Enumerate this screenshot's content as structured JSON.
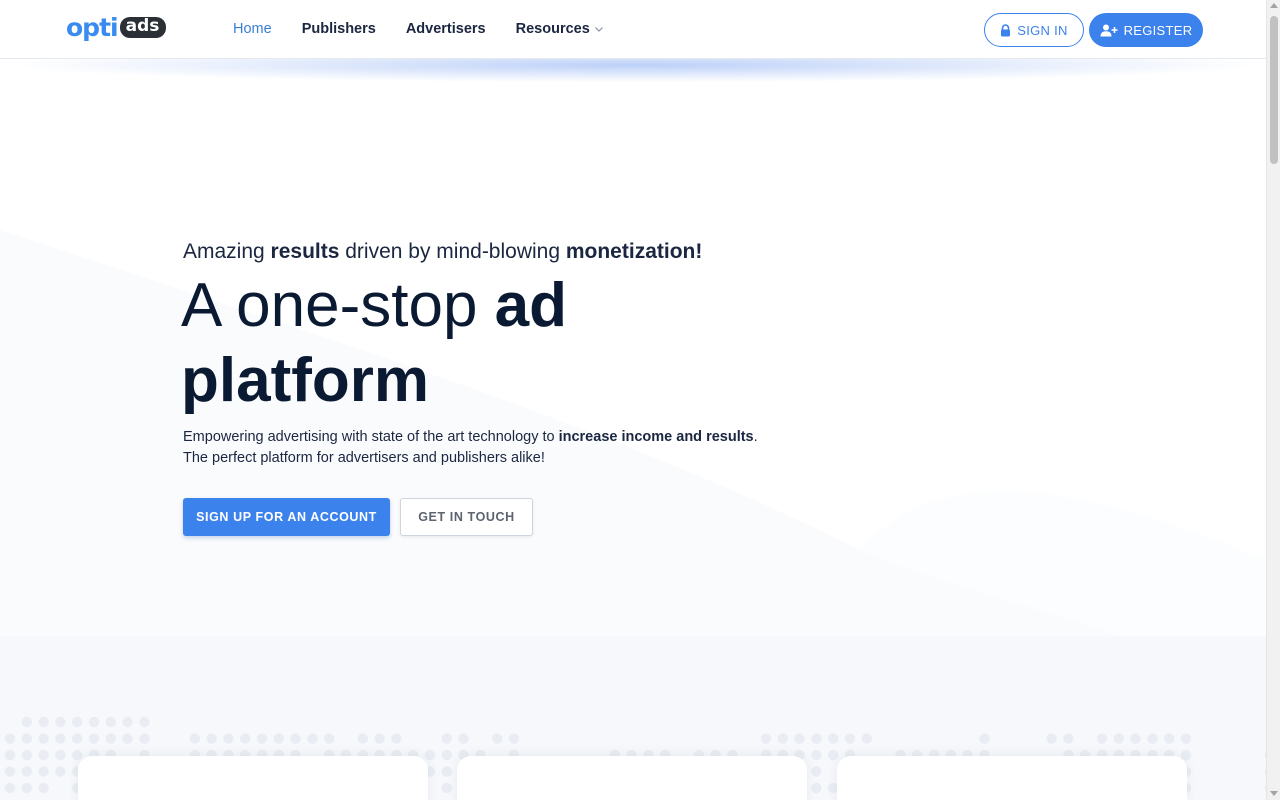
{
  "brand": {
    "logo_opti": "opti",
    "logo_ads": "ads",
    "accent": "#3c82ec"
  },
  "nav": {
    "items": [
      {
        "label": "Home",
        "active": true
      },
      {
        "label": "Publishers"
      },
      {
        "label": "Advertisers"
      },
      {
        "label": "Resources",
        "has_dropdown": true
      }
    ]
  },
  "auth": {
    "signin_label": "SIGN IN",
    "register_label": "REGISTER"
  },
  "hero": {
    "tagline_1": "Amazing ",
    "tagline_2": "results",
    "tagline_3": " driven by mind-blowing ",
    "tagline_4": "monetization!",
    "headline_1": "A one-stop ",
    "headline_2": "ad platform",
    "sub_1": "Empowering advertising with state of the art technology to ",
    "sub_2": "increase income and results",
    "sub_3": ".",
    "sub_line2": "The perfect platform for advertisers and publishers alike!",
    "cta_primary": "SIGN UP FOR AN ACCOUNT",
    "cta_secondary": "GET IN TOUCH"
  }
}
